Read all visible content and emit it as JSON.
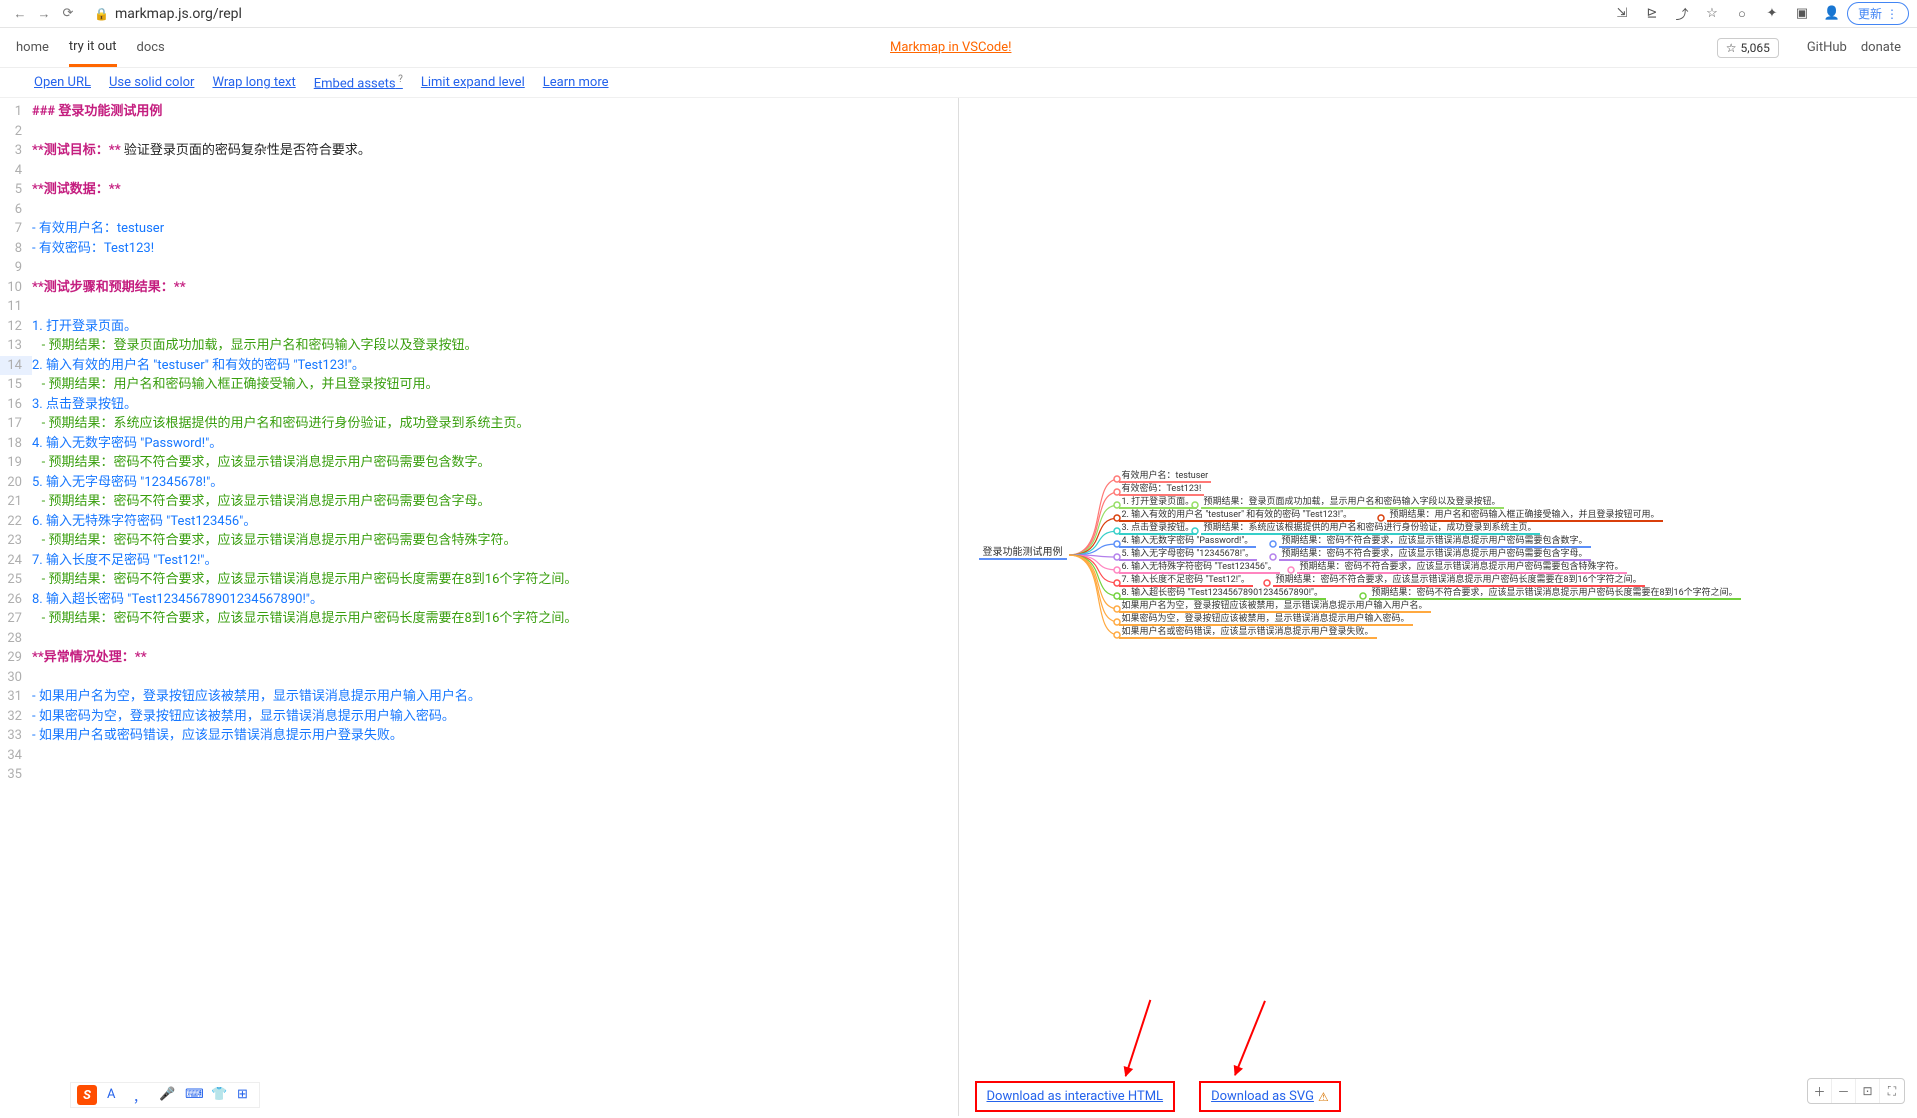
{
  "chrome": {
    "url": "markmap.js.org/repl",
    "update": "更新"
  },
  "header": {
    "tabs": [
      "home",
      "try it out",
      "docs"
    ],
    "banner": "Markmap in VSCode!",
    "stars": "5,065",
    "github": "GitHub",
    "donate": "donate"
  },
  "toolbar": {
    "l0": "Open URL",
    "l1": "Use solid color",
    "l2": "Wrap long text",
    "l3": "Embed assets",
    "l4": "Limit expand level",
    "l5": "Learn more"
  },
  "editor_lines": [
    {
      "n": 1,
      "raw": "### 登录功能测试用例",
      "cls": "kw1"
    },
    {
      "n": 2,
      "raw": "",
      "cls": ""
    },
    {
      "n": 3,
      "raw": "**测试目标：** 验证登录页面的密码复杂性是否符合要求。",
      "cls": "mix1"
    },
    {
      "n": 4,
      "raw": "",
      "cls": ""
    },
    {
      "n": 5,
      "raw": "**测试数据：**",
      "cls": "kw2"
    },
    {
      "n": 6,
      "raw": "",
      "cls": ""
    },
    {
      "n": 7,
      "raw": "- 有效用户名：testuser",
      "cls": "blu"
    },
    {
      "n": 8,
      "raw": "- 有效密码：Test123!",
      "cls": "blu"
    },
    {
      "n": 9,
      "raw": "",
      "cls": ""
    },
    {
      "n": 10,
      "raw": "**测试步骤和预期结果：**",
      "cls": "kw2"
    },
    {
      "n": 11,
      "raw": "",
      "cls": ""
    },
    {
      "n": 12,
      "raw": "1. 打开登录页面。",
      "cls": "blu"
    },
    {
      "n": 13,
      "raw": "   - 预期结果：登录页面成功加载，显示用户名和密码输入字段以及登录按钮。",
      "cls": "grn"
    },
    {
      "n": 14,
      "raw": "2. 输入有效的用户名 \"testuser\" 和有效的密码 \"Test123!\"。",
      "cls": "blu",
      "sel": true
    },
    {
      "n": 15,
      "raw": "   - 预期结果：用户名和密码输入框正确接受输入，并且登录按钮可用。",
      "cls": "grn"
    },
    {
      "n": 16,
      "raw": "3. 点击登录按钮。",
      "cls": "blu"
    },
    {
      "n": 17,
      "raw": "   - 预期结果：系统应该根据提供的用户名和密码进行身份验证，成功登录到系统主页。",
      "cls": "grn"
    },
    {
      "n": 18,
      "raw": "4. 输入无数字密码 \"Password!\"。",
      "cls": "blu"
    },
    {
      "n": 19,
      "raw": "   - 预期结果：密码不符合要求，应该显示错误消息提示用户密码需要包含数字。",
      "cls": "grn"
    },
    {
      "n": 20,
      "raw": "5. 输入无字母密码 \"12345678!\"。",
      "cls": "blu"
    },
    {
      "n": 21,
      "raw": "   - 预期结果：密码不符合要求，应该显示错误消息提示用户密码需要包含字母。",
      "cls": "grn"
    },
    {
      "n": 22,
      "raw": "6. 输入无特殊字符密码 \"Test123456\"。",
      "cls": "blu"
    },
    {
      "n": 23,
      "raw": "   - 预期结果：密码不符合要求，应该显示错误消息提示用户密码需要包含特殊字符。",
      "cls": "grn"
    },
    {
      "n": 24,
      "raw": "7. 输入长度不足密码 \"Test12!\"。",
      "cls": "blu"
    },
    {
      "n": 25,
      "raw": "   - 预期结果：密码不符合要求，应该显示错误消息提示用户密码长度需要在8到16个字符之间。",
      "cls": "grn"
    },
    {
      "n": 26,
      "raw": "8. 输入超长密码 \"Test12345678901234567890!\"。",
      "cls": "blu"
    },
    {
      "n": 27,
      "raw": "   - 预期结果：密码不符合要求，应该显示错误消息提示用户密码长度需要在8到16个字符之间。",
      "cls": "grn"
    },
    {
      "n": 28,
      "raw": "",
      "cls": ""
    },
    {
      "n": 29,
      "raw": "**异常情况处理：**",
      "cls": "kw2"
    },
    {
      "n": 30,
      "raw": "",
      "cls": ""
    },
    {
      "n": 31,
      "raw": "- 如果用户名为空，登录按钮应该被禁用，显示错误消息提示用户输入用户名。",
      "cls": "blu"
    },
    {
      "n": 32,
      "raw": "- 如果密码为空，登录按钮应该被禁用，显示错误消息提示用户输入密码。",
      "cls": "blu"
    },
    {
      "n": 33,
      "raw": "- 如果用户名或密码错误，应该显示错误消息提示用户登录失败。",
      "cls": "blu"
    },
    {
      "n": 34,
      "raw": "",
      "cls": ""
    },
    {
      "n": 35,
      "raw": "",
      "cls": ""
    }
  ],
  "mindmap": {
    "root": "登录功能测试用例",
    "level1": [
      {
        "t": "有效用户名：testuser",
        "c": "#ff7875"
      },
      {
        "t": "有效密码：Test123!",
        "c": "#ff7875"
      },
      {
        "t": "1. 打开登录页面。",
        "c": "#95de64",
        "r": "预期结果：登录页面成功加载，显示用户名和密码输入字段以及登录按钮。"
      },
      {
        "t": "2. 输入有效的用户名 \"testuser\" 和有效的密码 \"Test123!\"。",
        "c": "#d93f0b",
        "r": "预期结果：用户名和密码输入框正确接受输入，并且登录按钮可用。"
      },
      {
        "t": "3. 点击登录按钮。",
        "c": "#36cfc9",
        "r": "预期结果：系统应该根据提供的用户名和密码进行身份验证，成功登录到系统主页。"
      },
      {
        "t": "4. 输入无数字密码 \"Password!\"。",
        "c": "#5b8ff9",
        "r": "预期结果：密码不符合要求，应该显示错误消息提示用户密码需要包含数字。"
      },
      {
        "t": "5. 输入无字母密码 \"12345678!\"。",
        "c": "#b37feb",
        "r": "预期结果：密码不符合要求，应该显示错误消息提示用户密码需要包含字母。"
      },
      {
        "t": "6. 输入无特殊字符密码 \"Test123456\"。",
        "c": "#ff85c0",
        "r": "预期结果：密码不符合要求，应该显示错误消息提示用户密码需要包含特殊字符。"
      },
      {
        "t": "7. 输入长度不足密码 \"Test12!\"。",
        "c": "#ff4d4f",
        "r": "预期结果：密码不符合要求，应该显示错误消息提示用户密码长度需要在8到16个字符之间。"
      },
      {
        "t": "8. 输入超长密码 \"Test12345678901234567890!\"。",
        "c": "#73d13d",
        "r": "预期结果：密码不符合要求，应该显示错误消息提示用户密码长度需要在8到16个字符之间。"
      },
      {
        "t": "如果用户名为空，登录按钮应该被禁用，显示错误消息提示用户输入用户名。",
        "c": "#ffa940"
      },
      {
        "t": "如果密码为空，登录按钮应该被禁用，显示错误消息提示用户输入密码。",
        "c": "#ffa940"
      },
      {
        "t": "如果用户名或密码错误，应该显示错误消息提示用户登录失败。",
        "c": "#ffa940"
      }
    ]
  },
  "download": {
    "html": "Download as interactive HTML",
    "svg": "Download as SVG"
  },
  "icons": {
    "back": "←",
    "fwd": "→",
    "reload": "⟳",
    "lock": "🔒",
    "star": "☆",
    "ext": "⇲",
    "tr": "⊵",
    "share": "⤴",
    "circle": "○",
    "puzzle": "✦",
    "sq": "▣",
    "user": "👤",
    "dots": "⋮",
    "letterA": "A",
    "punct": "，",
    "mic": "🎤",
    "kbd": "⌨",
    "shirt": "👕",
    "grid": "⊞",
    "plus": "＋",
    "minus": "－",
    "fit": "⊡",
    "full": "⛶",
    "warn": "⚠"
  }
}
